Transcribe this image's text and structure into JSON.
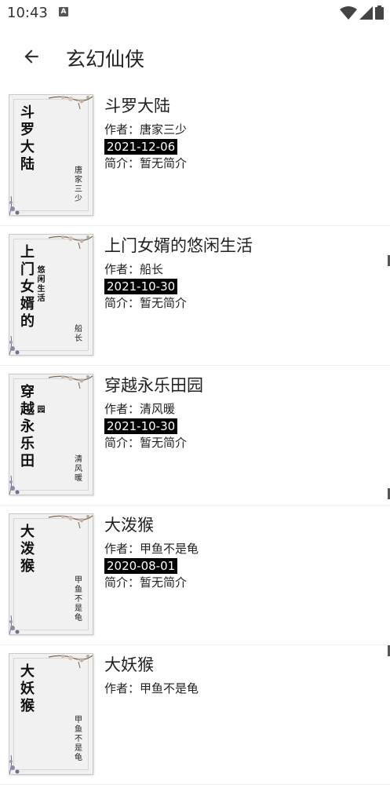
{
  "status": {
    "time": "10:43",
    "notification_badge": "A"
  },
  "app_bar": {
    "title": "玄幻仙侠",
    "back_icon": "arrow-left-icon"
  },
  "books": [
    {
      "title": "斗罗大陆",
      "cover_title": "斗罗大陆",
      "cover_title_small": "",
      "cover_author": "唐家三少",
      "author": "作者：唐家三少",
      "date": "2021-12-06",
      "intro": "简介：暂无简介"
    },
    {
      "title": "上门女婿的悠闲生活",
      "cover_title": "上门女婿的",
      "cover_title_small": "悠闲生活",
      "cover_author": "船长",
      "author": "作者：船长",
      "date": "2021-10-30",
      "intro": "简介：暂无简介"
    },
    {
      "title": "穿越永乐田园",
      "cover_title": "穿越永乐田",
      "cover_title_small": "园",
      "cover_author": "清风暖",
      "author": "作者：清风暖",
      "date": "2021-10-30",
      "intro": "简介：暂无简介"
    },
    {
      "title": "大泼猴",
      "cover_title": "大泼猴",
      "cover_title_small": "",
      "cover_author": "甲鱼不是龟",
      "author": "作者：甲鱼不是龟",
      "date": "2020-08-01",
      "intro": "简介：暂无简介"
    },
    {
      "title": "大妖猴",
      "cover_title": "大妖猴",
      "cover_title_small": "",
      "cover_author": "甲鱼不是龟",
      "author": "作者：甲鱼不是龟",
      "date": "",
      "intro": ""
    }
  ]
}
